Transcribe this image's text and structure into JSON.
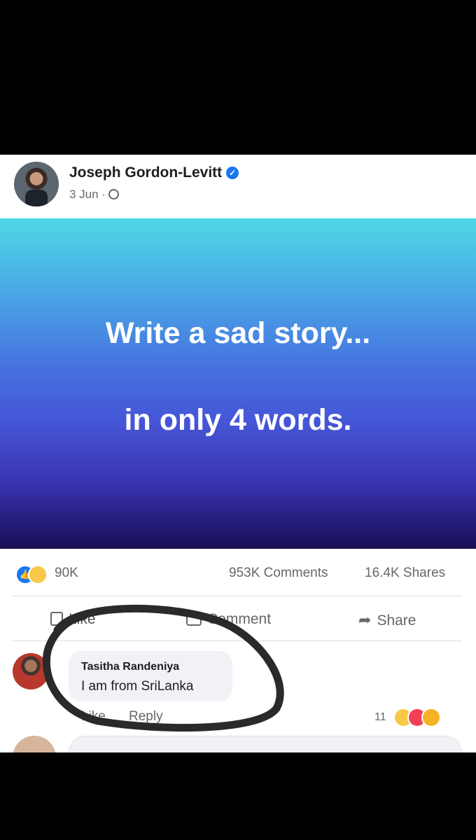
{
  "post": {
    "author_name": "Joseph Gordon-Levitt",
    "date": "3 Jun ·",
    "image_text_line1": "Write a sad story...",
    "image_text_line2": "in only 4 words."
  },
  "stats": {
    "reactions": "90K",
    "comments": "953K Comments",
    "shares": "16.4K Shares"
  },
  "actions": {
    "like": "Like",
    "comment": "Comment",
    "share": "Share"
  },
  "comment": {
    "author": "Tasitha Randeniya",
    "text": "I am from SriLanka",
    "like_label": "Like",
    "reply_label": "Reply",
    "reaction_count": "11"
  },
  "icons": {
    "verified": "verified-badge-icon",
    "privacy": "globe-icon",
    "reactions": [
      "like-reaction-icon",
      "sad-reaction-icon"
    ],
    "comment_reactions": [
      "haha-reaction-icon",
      "love-reaction-icon",
      "care-reaction-icon"
    ]
  },
  "colors": {
    "brand_blue": "#1877f2",
    "annotation": "#2a2a2a",
    "gradient_top": "#4fd8e6",
    "gradient_bottom": "#170f55"
  }
}
